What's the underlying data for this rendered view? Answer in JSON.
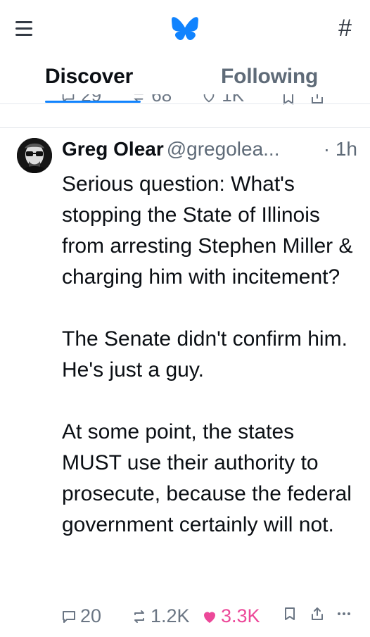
{
  "header": {
    "tabs": [
      {
        "label": "Discover",
        "active": true
      },
      {
        "label": "Following",
        "active": false
      }
    ],
    "hash_symbol": "#",
    "accent_color": "#1083fe"
  },
  "prev_post": {
    "reply_count": "29",
    "repost_count": "68",
    "like_count": "1K"
  },
  "post": {
    "author_name": "Greg Olear",
    "author_handle": "@gregolea...",
    "time": "· 1h",
    "text": "Serious question: What's stopping the State of Illinois from arresting Stephen Miller & charging him with incitement?\n\nThe Senate didn't confirm him. He's just a guy.\n\nAt some point, the states MUST use their authority to prosecute, because the federal government certainly will not.",
    "reply_count": "20",
    "repost_count": "1.2K",
    "like_count": "3.3K",
    "liked": true,
    "like_color": "#ec4899"
  },
  "icons": {
    "menu": "menu-icon",
    "logo": "butterfly-logo-icon",
    "feeds": "hash-icon",
    "reply": "reply-bubble-icon",
    "repost": "repost-icon",
    "like": "heart-icon",
    "bookmark": "bookmark-icon",
    "share": "share-icon",
    "more": "more-dots-icon"
  }
}
